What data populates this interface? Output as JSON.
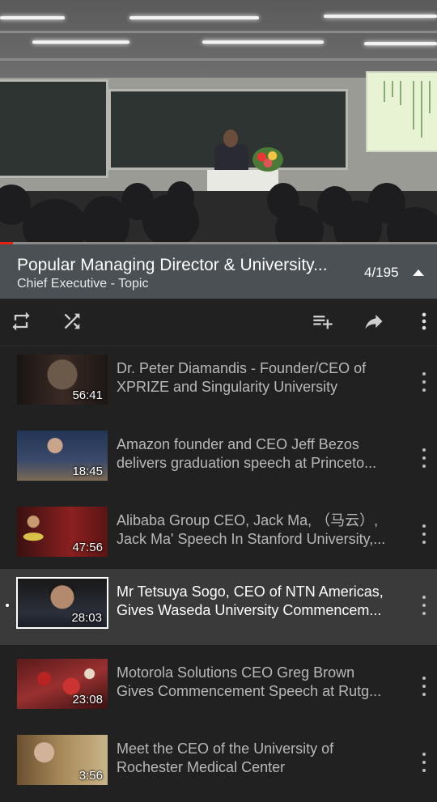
{
  "player": {
    "progress": 0.03,
    "accent_color": "#e62117"
  },
  "playlist": {
    "title": "Popular Managing Director & University...",
    "channel": "Chief Executive - Topic",
    "position": "4/195",
    "collapse_icon": "chevron-up-icon"
  },
  "controls": {
    "icons": [
      "repeat-icon",
      "shuffle-icon",
      "add-to-playlist-icon",
      "share-icon",
      "more-vert-icon"
    ]
  },
  "videos": [
    {
      "title_line1": "Dr. Peter Diamandis - Founder/CEO of",
      "title_line2": "XPRIZE and Singularity University",
      "duration": "56:41",
      "selected": false
    },
    {
      "title_line1": "Amazon founder and CEO Jeff Bezos",
      "title_line2": "delivers graduation speech at Princeto...",
      "duration": "18:45",
      "selected": false
    },
    {
      "title_line1": "Alibaba Group CEO, Jack Ma, （马云）,",
      "title_line2": "Jack Ma' Speech In Stanford University,...",
      "duration": "47:56",
      "selected": false
    },
    {
      "title_line1": "Mr Tetsuya Sogo, CEO of NTN Americas,",
      "title_line2": "Gives Waseda University Commencem...",
      "duration": "28:03",
      "selected": true
    },
    {
      "title_line1": "Motorola Solutions CEO Greg Brown",
      "title_line2": "Gives Commencement Speech at Rutg...",
      "duration": "23:08",
      "selected": false
    },
    {
      "title_line1": "Meet the CEO of the University of",
      "title_line2": "Rochester Medical Center",
      "duration": "3:56",
      "selected": false
    }
  ]
}
